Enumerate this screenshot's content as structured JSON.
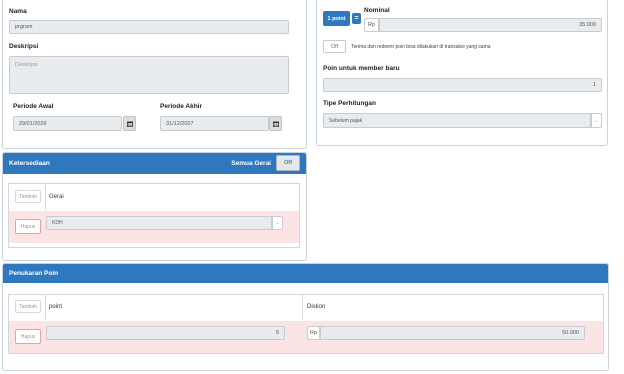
{
  "product": {
    "nama_label": "Nama",
    "nama_value": "prgram",
    "deskripsi_label": "Deskripsi",
    "deskripsi_placeholder": "Deskripsi",
    "periode_awal_label": "Periode Awal",
    "periode_awal_value": "29/01/2026",
    "periode_akhir_label": "Periode Akhir",
    "periode_akhir_value": "31/12/2027"
  },
  "poin": {
    "badge_label": "1 point",
    "equals": "=",
    "nominal_label": "Nominal",
    "currency": "Rp",
    "nominal_value": "35.000",
    "toggle_label": "Off",
    "toggle_text": "Terima dan redeem poin bisa dilakukan di transaksi yang sama",
    "member_baru_label": "Poin untuk member baru",
    "member_baru_value": "1",
    "tipe_label": "Tipe Perhitungan",
    "tipe_value": "Sebelum pajak"
  },
  "ketersediaan": {
    "title": "Ketersediaan",
    "semua_label": "Semua Gerai",
    "semua_toggle": "Off",
    "tambah_label": "Tambah",
    "col_gerai": "Gerai",
    "hapus_label": "Hapus",
    "gerai_value": "KDH"
  },
  "penukaran": {
    "title": "Penukaran Poin",
    "tambah_label": "Tambah",
    "col_point": "point",
    "col_diskon": "Diskon",
    "hapus_label": "Hapus",
    "point_value": "5",
    "currency": "Rp",
    "diskon_value": "50.000"
  },
  "icons": {
    "calendar": "calendar-icon",
    "dropdown": "chevron-down-icon"
  }
}
